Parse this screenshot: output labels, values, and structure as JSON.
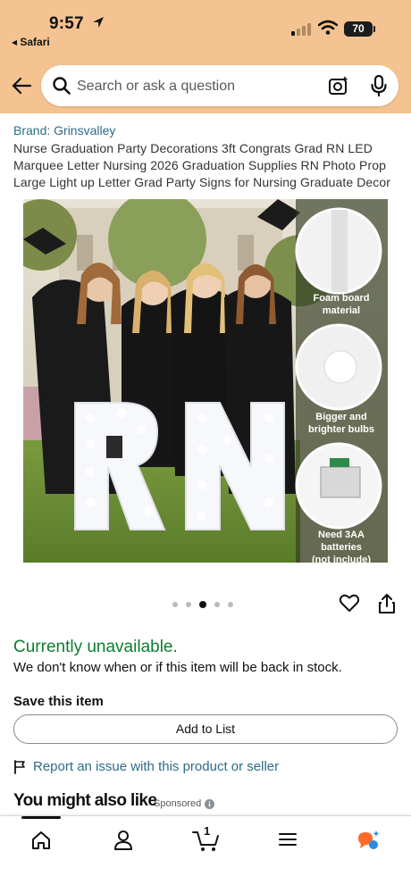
{
  "status_bar": {
    "time": "9:57",
    "back_app": "◂ Safari",
    "battery": "70"
  },
  "search": {
    "placeholder": "Search or ask a question"
  },
  "product": {
    "brand": "Brand: Grinsvalley",
    "title": "Nurse Graduation Party Decorations 3ft Congrats Grad RN LED Marquee Letter Nursing 2026 Graduation Supplies RN Photo Prop Large Light up Letter Grad Party Signs for Nursing Graduate Decor",
    "image": {
      "letters": "RN",
      "callouts": [
        {
          "line1": "Foam board",
          "line2": "material"
        },
        {
          "line1": "Bigger and",
          "line2": "brighter bulbs"
        },
        {
          "line1": "Need 3AA batteries",
          "line2": "(not include)"
        }
      ]
    },
    "carousel": {
      "count": 5,
      "active_index": 2
    }
  },
  "availability": {
    "status": "Currently unavailable.",
    "message": "We don't know when or if this item will be back in stock."
  },
  "save": {
    "title": "Save this item",
    "button": "Add to List"
  },
  "report_link": "Report an issue with this product or seller",
  "recommendations": {
    "title": "You might also like",
    "sponsored": "Sponsored"
  },
  "bottom_nav": {
    "cart_count": "1",
    "items": [
      "home-icon",
      "account-icon",
      "cart-icon",
      "menu-icon",
      "rufus-icon"
    ]
  },
  "colors": {
    "header": "#f4c391",
    "link": "#2d6c87",
    "unavailable": "#0a7d2f",
    "rufus": "#ff6a2a"
  }
}
